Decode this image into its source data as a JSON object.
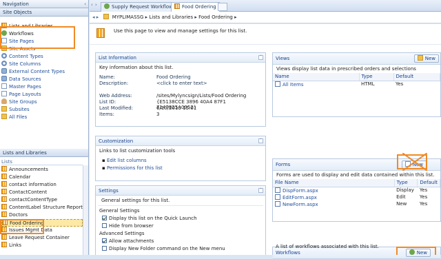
{
  "nav": {
    "title": "Navigation",
    "site_objects_header": "Site Objects",
    "site_objects": [
      {
        "label": "Lists and Libraries",
        "icon": "list-icon"
      },
      {
        "label": "Workflows",
        "icon": "workflow-icon"
      },
      {
        "label": "Site Pages",
        "icon": "page-icon"
      },
      {
        "label": "Site Assets",
        "icon": "folder-icon"
      },
      {
        "label": "Content Types",
        "icon": "gear-icon"
      },
      {
        "label": "Site Columns",
        "icon": "gear-icon"
      },
      {
        "label": "External Content Types",
        "icon": "db-icon"
      },
      {
        "label": "Data Sources",
        "icon": "db-icon"
      },
      {
        "label": "Master Pages",
        "icon": "page-icon"
      },
      {
        "label": "Page Layouts",
        "icon": "page-icon"
      },
      {
        "label": "Site Groups",
        "icon": "users-icon"
      },
      {
        "label": "Subsites",
        "icon": "folder-icon"
      },
      {
        "label": "All Files",
        "icon": "folder-icon"
      }
    ],
    "lists_header": "Lists and Libraries",
    "lists_sub": "Lists",
    "lists": [
      "Announcements",
      "Calendar",
      "contact information",
      "ContactContent",
      "contactContentType",
      "ContentLabel Structure Reports",
      "Doctors",
      "Food Ordering",
      "Issues Mgmt Data",
      "Leave Request Container",
      "Links"
    ]
  },
  "tabs": [
    {
      "label": "Supply Request Workflow"
    },
    {
      "label": "Food Ordering"
    }
  ],
  "breadcrumb": {
    "site": "MYPLIMASSG",
    "section": "Lists and Libraries",
    "item": "Food Ordering"
  },
  "intro": "Use this page to view and manage settings for this list.",
  "list_info": {
    "title": "List Information",
    "desc": "Key information about this list.",
    "name_label": "Name:",
    "name": "Food Ordering",
    "description_label": "Description:",
    "description": "<click to enter text>",
    "web_label": "Web Address:",
    "web": "/sites/Mylyncsign/Lists/Food Ordering",
    "id_label": "List ID:",
    "id": "{E5138CCE 3896 40A4 87F1 7147825A0952}",
    "modified_label": "Last Modified:",
    "modified": "6/10/2013 15:01",
    "items_label": "Items:",
    "items": "3"
  },
  "customization": {
    "title": "Customization",
    "desc": "Links to list customization tools",
    "links": [
      "Edit list columns",
      "Permissions for this list"
    ]
  },
  "settings": {
    "title": "Settings",
    "desc": "General settings for this list.",
    "general_label": "General Settings",
    "options": [
      {
        "label": "Display this list on the Quick Launch",
        "checked": true
      },
      {
        "label": "Hide from browser",
        "checked": false
      }
    ],
    "advanced_label": "Advanced Settings",
    "advanced": [
      {
        "label": "Allow attachments",
        "checked": true
      },
      {
        "label": "Display New Folder command on the New menu",
        "checked": false
      }
    ]
  },
  "views": {
    "title": "Views",
    "new_label": "New",
    "desc": "Views display list data in prescribed orders and selections",
    "columns": [
      "Name",
      "Type",
      "Default"
    ],
    "rows": [
      {
        "name": "All Items",
        "type": "HTML",
        "default": "Yes"
      }
    ]
  },
  "forms": {
    "title": "Forms",
    "new_label": "New",
    "desc": "Forms are used to display and edit data contained within this list.",
    "columns": [
      "File Name",
      "Type",
      "Default"
    ],
    "rows": [
      {
        "name": "DispForm.aspx",
        "type": "Display",
        "default": "Yes"
      },
      {
        "name": "EditForm.aspx",
        "type": "Edit",
        "default": "Yes"
      },
      {
        "name": "NewForm.aspx",
        "type": "New",
        "default": "Yes"
      }
    ]
  },
  "workflows": {
    "title": "Workflows",
    "new_label": "New",
    "desc": "A list of workflows associated with this list."
  },
  "colors": {
    "highlight": "#f08a24",
    "selected": "#fde9a4",
    "header": "#15428b"
  }
}
